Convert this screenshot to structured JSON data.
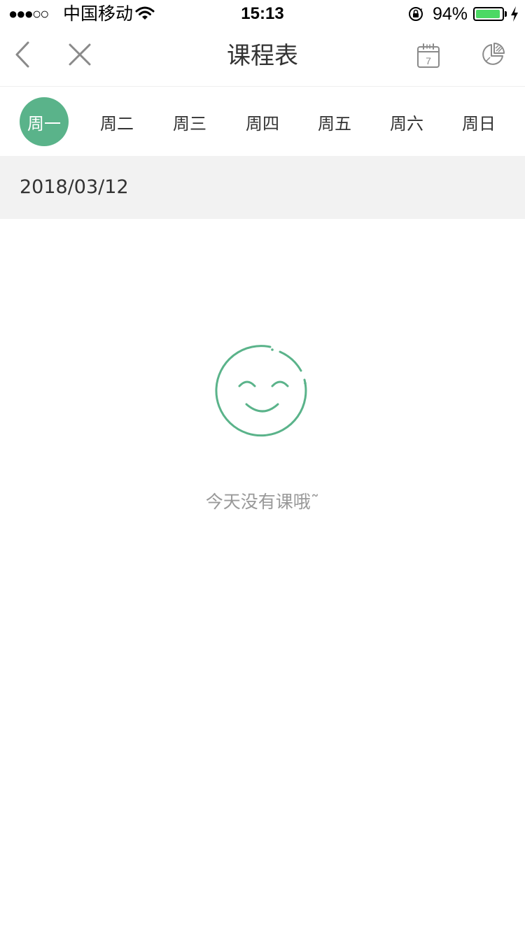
{
  "status_bar": {
    "signal": "●●●○○",
    "carrier": "中国移动",
    "time": "15:13",
    "battery_percent": "94%",
    "battery_level": 0.94,
    "battery_color": "#4cd964"
  },
  "nav": {
    "title": "课程表",
    "back_icon": "chevron-left-icon",
    "close_icon": "close-icon",
    "calendar_icon": "calendar-icon",
    "calendar_day": "7",
    "chart_icon": "pie-chart-icon"
  },
  "week_tabs": {
    "days": [
      "周一",
      "周二",
      "周三",
      "周四",
      "周五",
      "周六",
      "周日"
    ],
    "active_index": 0,
    "active_color": "#5ab38a"
  },
  "date": "2018/03/12",
  "empty_state": {
    "icon": "smiley-face-icon",
    "message": "今天没有课哦˜",
    "accent_color": "#5ab38a"
  }
}
